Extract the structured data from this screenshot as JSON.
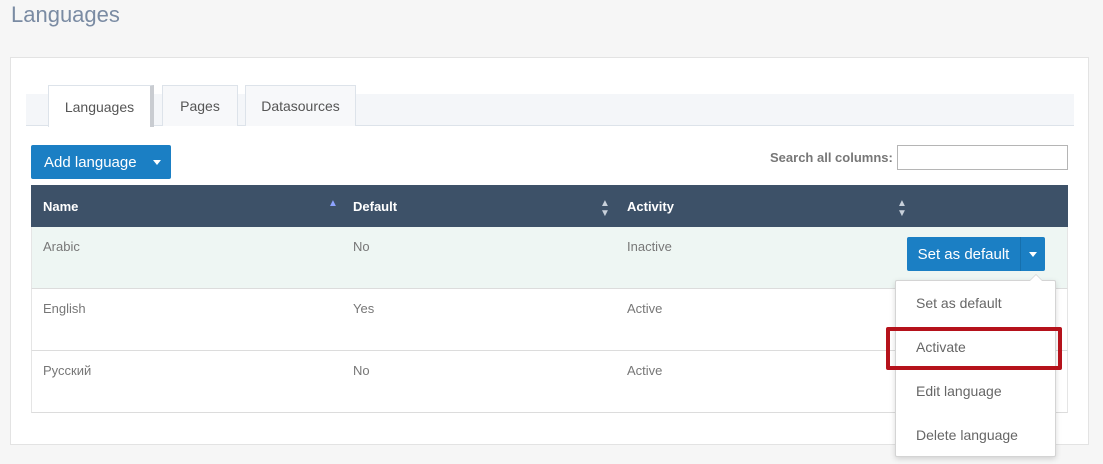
{
  "page": {
    "title": "Languages"
  },
  "tabs": [
    {
      "label": "Languages",
      "active": true
    },
    {
      "label": "Pages",
      "active": false
    },
    {
      "label": "Datasources",
      "active": false
    }
  ],
  "toolbar": {
    "add_label": "Add language"
  },
  "search": {
    "label": "Search all columns:",
    "value": ""
  },
  "table": {
    "columns": [
      "Name",
      "Default",
      "Activity"
    ],
    "rows": [
      {
        "name": "Arabic",
        "default": "No",
        "activity": "Inactive"
      },
      {
        "name": "English",
        "default": "Yes",
        "activity": "Active"
      },
      {
        "name": "Русский",
        "default": "No",
        "activity": "Active"
      }
    ]
  },
  "row_action": {
    "label": "Set as default"
  },
  "dropdown": {
    "items": [
      "Set as default",
      "Activate",
      "Edit language",
      "Delete language"
    ],
    "highlighted": "Activate"
  },
  "colors": {
    "primary": "#1b7fc4",
    "header_bg": "#3d5168",
    "highlight_border": "#b5121b",
    "row_highlight": "#eef6f3"
  },
  "icons": [
    "caret-down-icon",
    "sort-asc-icon",
    "sort-both-icon"
  ]
}
